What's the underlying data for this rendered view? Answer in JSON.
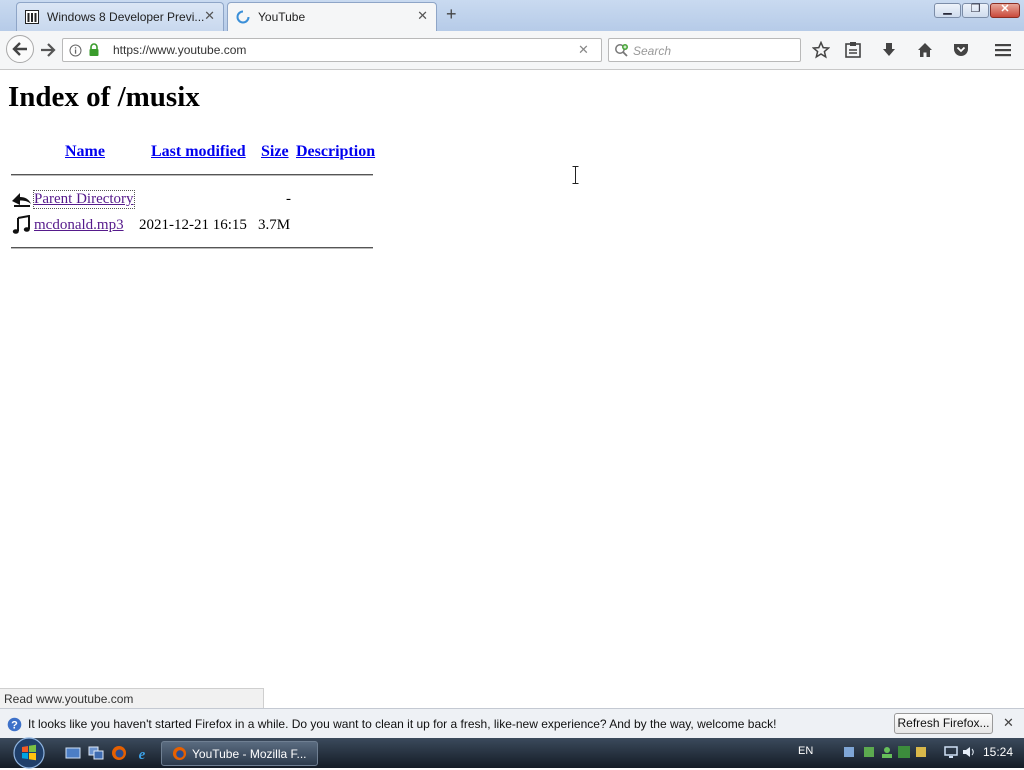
{
  "browser": {
    "tabs": [
      {
        "label": "Windows 8 Developer Previ...",
        "icon": "window-icon",
        "active": false
      },
      {
        "label": "YouTube",
        "icon": "loading-spinner-icon",
        "active": true
      }
    ],
    "url": "https://www.youtube.com",
    "search_placeholder": "Search"
  },
  "page": {
    "title": "Index of /musix",
    "headers": [
      "Name",
      "Last modified",
      "Size",
      "Description"
    ],
    "rows": [
      {
        "name": "Parent Directory",
        "modified": "",
        "size": "-",
        "description": "",
        "icon": "back-arrow-icon"
      },
      {
        "name": "mcdonald.mp3",
        "modified": "2021-12-21 16:15",
        "size": "3.7M",
        "description": "",
        "icon": "music-note-icon"
      }
    ]
  },
  "status": "Read www.youtube.com",
  "notification": {
    "text": "It looks like you haven't started Firefox in a while. Do you want to clean it up for a fresh, like-new experience? And by the way, welcome back!",
    "button": "Refresh Firefox..."
  },
  "taskbar": {
    "active_window": "YouTube - Mozilla F...",
    "language": "EN",
    "time": "15:24"
  },
  "colors": {
    "link": "#0000ee",
    "visited_link": "#551a8b",
    "tabbar": "#b6cbe8",
    "taskbar": "#141c26"
  }
}
